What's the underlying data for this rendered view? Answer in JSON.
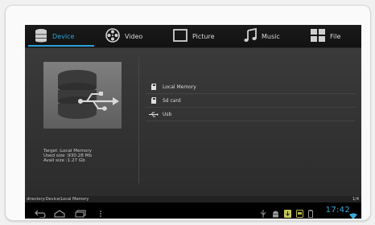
{
  "tabs": [
    {
      "label": "Device",
      "icon": "database-icon",
      "active": true
    },
    {
      "label": "Video",
      "icon": "film-reel-icon",
      "active": false
    },
    {
      "label": "Picture",
      "icon": "picture-frame-icon",
      "active": false
    },
    {
      "label": "Music",
      "icon": "music-note-icon",
      "active": false
    },
    {
      "label": "File",
      "icon": "folder-grid-icon",
      "active": false
    }
  ],
  "device": {
    "target": "Target :Local Memory",
    "used": "Used size :930.28 Mb",
    "avail": "Avail size :1.27 Gb"
  },
  "storage": [
    {
      "label": "Local Memory",
      "icon": "sd-card-icon"
    },
    {
      "label": "Sd card",
      "icon": "sd-card-icon"
    },
    {
      "label": "Usb",
      "icon": "usb-icon"
    }
  ],
  "path": "directory:Device/Local Memory",
  "page": "1/4",
  "status": {
    "time": "17:42"
  },
  "colors": {
    "accent": "#2aa3dc",
    "clock": "#3aa7d9"
  }
}
